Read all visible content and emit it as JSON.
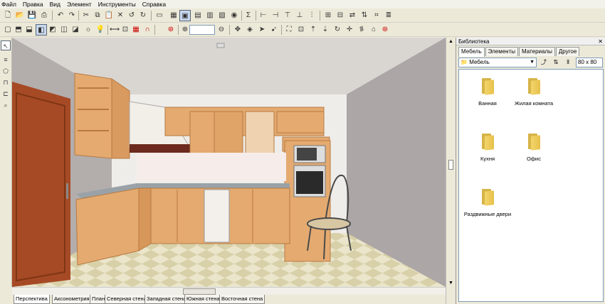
{
  "menu": [
    "Файл",
    "Правка",
    "Вид",
    "Элемент",
    "Инструменты",
    "Справка"
  ],
  "library": {
    "title": "Библиотека",
    "tabs": [
      "Мебель",
      "Элементы",
      "Материалы",
      "Другое"
    ],
    "path": "Мебель",
    "size": "80 x 80",
    "folders": [
      "Ванная",
      "Жилая комната",
      "Кухня",
      "Офис",
      "Раздвижные двери"
    ]
  },
  "view_tabs": [
    "Перспектива",
    "Аксонометрия",
    "План",
    "Северная стена",
    "Западная стена",
    "Южная стена",
    "Восточная стена"
  ],
  "colors": {
    "wood": "#e0a56a",
    "wall_left": "#b3adac",
    "wall_right": "#aca6a7",
    "floor": "#e8e2c8",
    "door": "#a64a25"
  }
}
